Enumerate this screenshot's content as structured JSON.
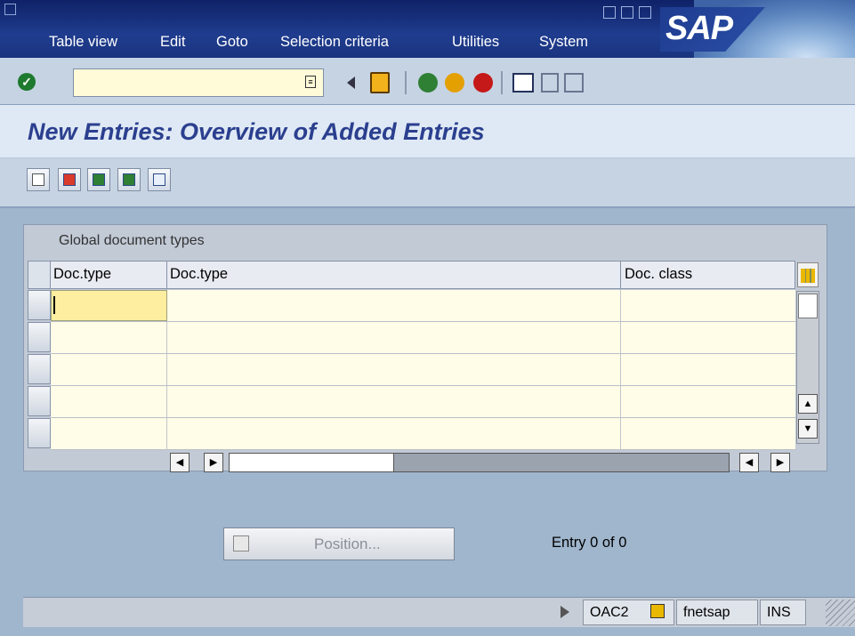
{
  "menu": {
    "items": [
      "Table view",
      "Edit",
      "Goto",
      "Selection criteria",
      "Utilities",
      "System"
    ]
  },
  "brand": {
    "logo_text": "SAP",
    "accent": "#1f3c8e"
  },
  "toolbar": {
    "command_value": "",
    "icons": [
      "enter-icon",
      "back-icon",
      "save-icon",
      "back-green-icon",
      "exit-icon",
      "cancel-icon",
      "print-icon",
      "find-icon",
      "find-next-icon"
    ]
  },
  "page": {
    "title": "New Entries: Overview of Added Entries"
  },
  "apptoolbar": {
    "icons": [
      "change-display-icon",
      "delete-icon",
      "select-all-icon",
      "select-block-icon",
      "deselect-all-icon"
    ]
  },
  "table": {
    "title": "Global document types",
    "columns": [
      "Doc.type",
      "Doc.type",
      "Doc. class"
    ],
    "rows": [
      [
        "",
        "",
        ""
      ],
      [
        "",
        "",
        ""
      ],
      [
        "",
        "",
        ""
      ],
      [
        "",
        "",
        ""
      ],
      [
        "",
        "",
        ""
      ]
    ]
  },
  "actions": {
    "position_label": "Position...",
    "entry_count": "Entry 0 of 0"
  },
  "status": {
    "transaction": "OAC2",
    "server": "fnetsap",
    "mode": "INS"
  }
}
